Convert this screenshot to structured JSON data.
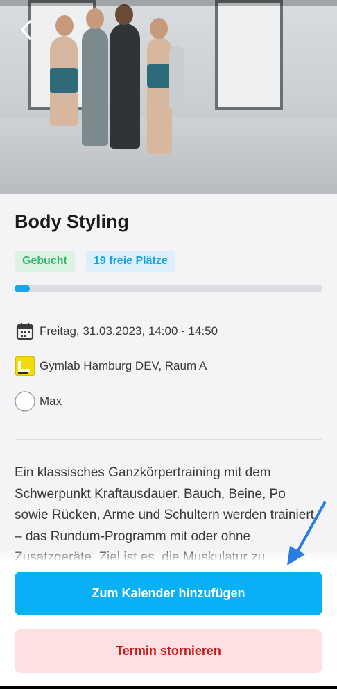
{
  "class": {
    "title": "Body Styling",
    "badges": {
      "booked": "Gebucht",
      "free": "19 freie Plätze"
    },
    "capacity_fraction": 0.05,
    "date": "Freitag, 31.03.2023, 14:00 - 14:50",
    "location": "Gymlab Hamburg DEV, Raum A",
    "trainer": "Max",
    "description": "Ein klassisches Ganzkörpertraining mit dem Schwerpunkt Kraftausdauer. Bauch, Beine, Po sowie Rücken, Arme und Schultern werden trainiert – das Rundum-Programm mit oder ohne Zusatzgeräte. Ziel ist es, die Muskulatur zu"
  },
  "actions": {
    "add_calendar": "Zum Kalender hinzufügen",
    "cancel": "Termin stornieren"
  },
  "icons": {
    "back": "chevron-left-icon",
    "calendar": "calendar-icon",
    "location": "gym-logo-icon",
    "trainer": "avatar-circle",
    "annotation": "blue-arrow"
  },
  "colors": {
    "primary": "#0ab0f5",
    "booked_bg": "#dcf3e4",
    "booked_text": "#34b86a",
    "free_bg": "#dcf0fb",
    "free_text": "#18a5dd",
    "cancel_bg": "#fde0e2",
    "cancel_text": "#c91a1a",
    "arrow": "#2a7de1"
  }
}
